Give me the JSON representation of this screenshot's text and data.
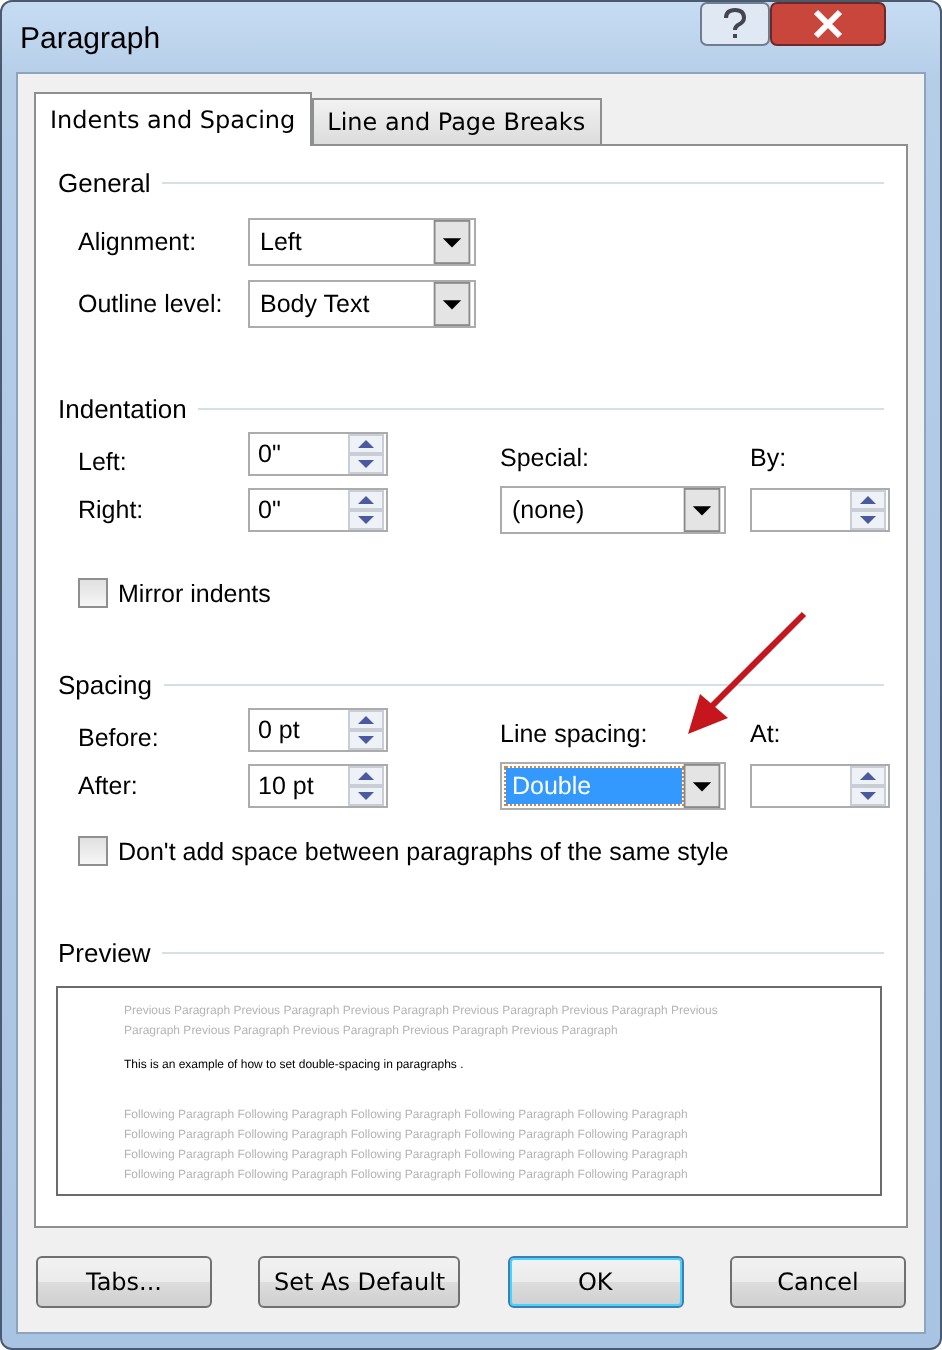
{
  "window": {
    "title": "Paragraph"
  },
  "tabs": [
    {
      "label": "Indents and Spacing",
      "selected": true
    },
    {
      "label": "Line and Page Breaks",
      "selected": false
    }
  ],
  "general": {
    "heading": "General",
    "fields": [
      {
        "label": "Alignment:",
        "value": "Left"
      },
      {
        "label": "Outline level:",
        "value": "Body Text"
      }
    ]
  },
  "indentation": {
    "heading": "Indentation",
    "left": {
      "label": "Left:",
      "value": "0\""
    },
    "right": {
      "label": "Right:",
      "value": "0\""
    },
    "special": {
      "label": "Special:",
      "value": "(none)",
      "selected": false
    },
    "by": {
      "label": "By:"
    },
    "mirror_indents": {
      "label": "Mirror indents",
      "checked": false
    }
  },
  "spacing": {
    "heading": "Spacing",
    "before": {
      "label": "Before:",
      "value": "0 pt"
    },
    "after": {
      "label": "After:",
      "value": "10 pt"
    },
    "line_spacing": {
      "label": "Line spacing:",
      "value": "Double",
      "selected": true
    },
    "at": {
      "label": "At:"
    },
    "dont_add_space": {
      "label": "Don't add space between paragraphs of the same style",
      "checked": false
    }
  },
  "preview": {
    "heading": "Preview",
    "previous_lines": [
      "Previous Paragraph Previous Paragraph Previous Paragraph Previous Paragraph Previous Paragraph Previous",
      "Paragraph Previous Paragraph Previous Paragraph Previous Paragraph Previous Paragraph"
    ],
    "sample": "This is an example of how to set double-spacing in paragraphs .",
    "following_lines": [
      "Following Paragraph Following Paragraph Following Paragraph Following Paragraph Following Paragraph",
      "Following Paragraph Following Paragraph Following Paragraph Following Paragraph Following Paragraph",
      "Following Paragraph Following Paragraph Following Paragraph Following Paragraph Following Paragraph",
      "Following Paragraph Following Paragraph Following Paragraph Following Paragraph Following Paragraph"
    ]
  },
  "buttons": [
    {
      "label": "Tabs...",
      "default": false
    },
    {
      "label": "Set As Default",
      "default": false
    },
    {
      "label": "OK",
      "default": true
    },
    {
      "label": "Cancel",
      "default": false
    }
  ]
}
